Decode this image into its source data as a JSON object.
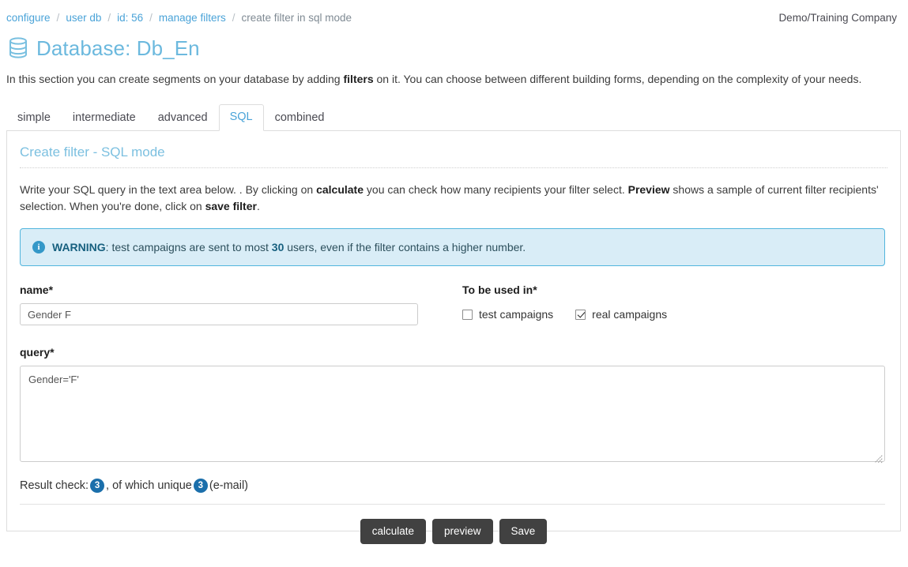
{
  "breadcrumb": {
    "items": [
      {
        "label": "configure",
        "current": false
      },
      {
        "label": "user db",
        "current": false
      },
      {
        "label": "id: 56",
        "current": false
      },
      {
        "label": "manage filters",
        "current": false
      },
      {
        "label": "create filter in sql mode",
        "current": true
      }
    ],
    "separator": "/"
  },
  "header": {
    "company": "Demo/Training Company",
    "title": "Database: Db_En",
    "db_icon": "database-icon"
  },
  "intro": {
    "part1": "In this section you can create segments on your database by adding ",
    "bold1": "filters",
    "part2": " on it. You can choose between different building forms, depending on the complexity of your needs."
  },
  "tabs": [
    {
      "label": "simple",
      "active": false
    },
    {
      "label": "intermediate",
      "active": false
    },
    {
      "label": "advanced",
      "active": false
    },
    {
      "label": "SQL",
      "active": true
    },
    {
      "label": "combined",
      "active": false
    }
  ],
  "panel": {
    "title": "Create filter - SQL mode",
    "desc_part1": "Write your SQL query in the text area below. . By clicking on ",
    "desc_bold1": "calculate",
    "desc_part2": " you can check how many recipients your filter select. ",
    "desc_bold2": "Preview",
    "desc_part3": " shows a sample of current filter recipients' selection. When you're done, click on ",
    "desc_bold3": "save filter",
    "desc_part4": "."
  },
  "alert": {
    "icon": "info-circle-icon",
    "bold": "WARNING",
    "text_part1": ": test campaigns are sent to most ",
    "bold_number": "30",
    "text_part2": " users, even if the filter contains a higher number."
  },
  "form": {
    "name_label": "name*",
    "name_value": "Gender F",
    "name_placeholder": "name",
    "used_in_label": "To be used in*",
    "checkboxes": [
      {
        "label": "test campaigns",
        "checked": false
      },
      {
        "label": "real campaigns",
        "checked": true
      }
    ],
    "query_label": "query*",
    "query_value": "Gender='F'",
    "query_placeholder": "query"
  },
  "result": {
    "prefix": "Result check:",
    "count": "3",
    "middle": ", of which unique",
    "unique": "3",
    "suffix": "(e-mail)"
  },
  "buttons": [
    {
      "label": "calculate",
      "name": "calculate-button"
    },
    {
      "label": "preview",
      "name": "preview-button"
    },
    {
      "label": "Save",
      "name": "save-button"
    }
  ],
  "colors": {
    "accent": "#4aa3d8",
    "title": "#6cb9de",
    "alert_bg": "#d9edf7",
    "alert_border": "#52b5dd",
    "badge": "#1b6fab",
    "button": "#414141"
  }
}
